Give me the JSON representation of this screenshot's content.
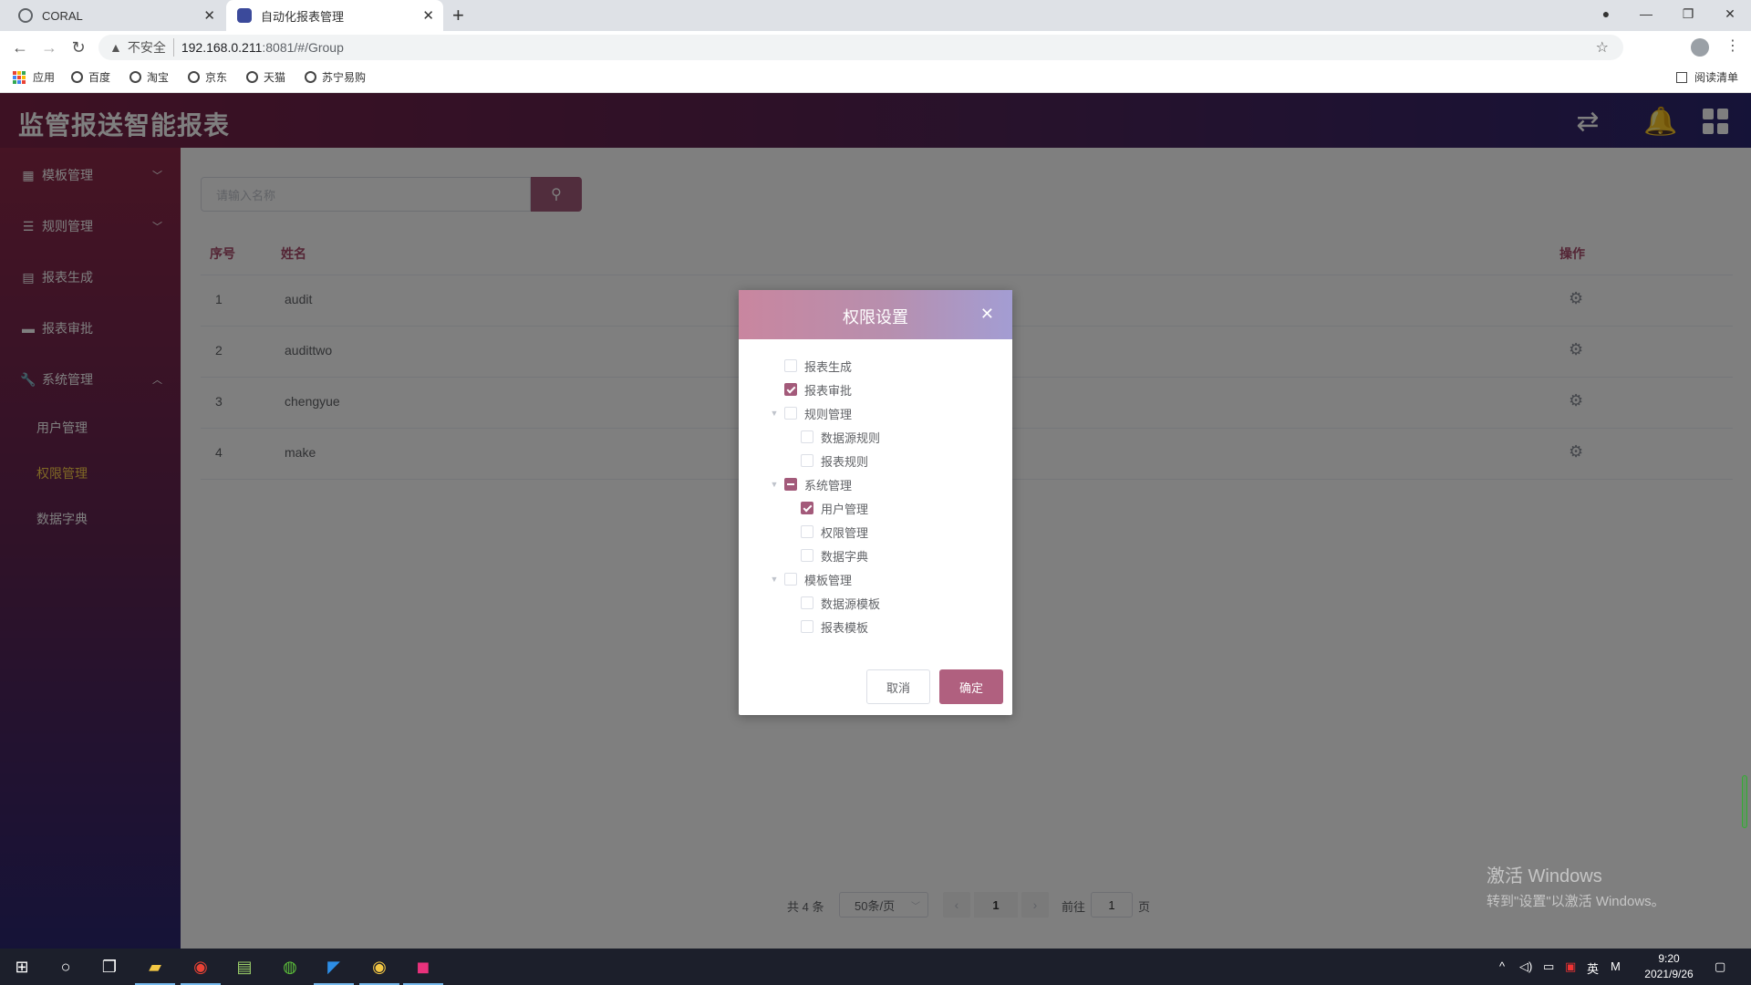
{
  "browser": {
    "tabs": [
      {
        "title": "CORAL",
        "active": false
      },
      {
        "title": "自动化报表管理",
        "active": true
      }
    ],
    "security_label": "不安全",
    "url_host": "192.168.0.211",
    "url_rest": ":8081/#/Group",
    "bookmarks": [
      "应用",
      "百度",
      "淘宝",
      "京东",
      "天猫",
      "苏宁易购"
    ],
    "reading_list": "阅读清单"
  },
  "app": {
    "title": "监管报送智能报表",
    "accent_color": "#a35a7a"
  },
  "sidebar": {
    "items": [
      {
        "label": "模板管理",
        "icon": "grid-icon",
        "expanded": false
      },
      {
        "label": "规则管理",
        "icon": "list-icon",
        "expanded": false
      },
      {
        "label": "报表生成",
        "icon": "printer-icon"
      },
      {
        "label": "报表审批",
        "icon": "card-icon"
      },
      {
        "label": "系统管理",
        "icon": "wrench-icon",
        "expanded": true
      }
    ],
    "sub_items": [
      {
        "label": "用户管理",
        "active": false
      },
      {
        "label": "权限管理",
        "active": true
      },
      {
        "label": "数据字典",
        "active": false
      }
    ]
  },
  "search": {
    "placeholder": "请输入名称"
  },
  "table": {
    "columns": {
      "index": "序号",
      "name": "姓名",
      "action": "操作"
    },
    "rows": [
      {
        "index": "1",
        "name": "audit"
      },
      {
        "index": "2",
        "name": "audittwo"
      },
      {
        "index": "3",
        "name": "chengyue"
      },
      {
        "index": "4",
        "name": "make"
      }
    ]
  },
  "pagination": {
    "total": "共 4 条",
    "page_size": "50条/页",
    "current_page": "1",
    "goto_label": "前往",
    "goto_value": "1",
    "page_suffix": "页"
  },
  "dialog": {
    "title": "权限设置",
    "tree": [
      {
        "label": "报表生成",
        "level": 0,
        "state": "unchecked",
        "arrow": false
      },
      {
        "label": "报表审批",
        "level": 0,
        "state": "checked",
        "arrow": false
      },
      {
        "label": "规则管理",
        "level": 0,
        "state": "unchecked",
        "arrow": true
      },
      {
        "label": "数据源规则",
        "level": 1,
        "state": "unchecked",
        "arrow": false
      },
      {
        "label": "报表规则",
        "level": 1,
        "state": "unchecked",
        "arrow": false
      },
      {
        "label": "系统管理",
        "level": 0,
        "state": "indeterminate",
        "arrow": true
      },
      {
        "label": "用户管理",
        "level": 1,
        "state": "checked",
        "arrow": false
      },
      {
        "label": "权限管理",
        "level": 1,
        "state": "unchecked",
        "arrow": false
      },
      {
        "label": "数据字典",
        "level": 1,
        "state": "unchecked",
        "arrow": false
      },
      {
        "label": "模板管理",
        "level": 0,
        "state": "unchecked",
        "arrow": true
      },
      {
        "label": "数据源模板",
        "level": 1,
        "state": "unchecked",
        "arrow": false
      },
      {
        "label": "报表模板",
        "level": 1,
        "state": "unchecked",
        "arrow": false
      }
    ],
    "cancel_label": "取消",
    "confirm_label": "确定"
  },
  "watermark": {
    "line1": "激活 Windows",
    "line2": "转到\"设置\"以激活 Windows。"
  },
  "taskbar": {
    "ime": "英",
    "ime2": "M",
    "time": "9:20",
    "date": "2021/9/26"
  }
}
